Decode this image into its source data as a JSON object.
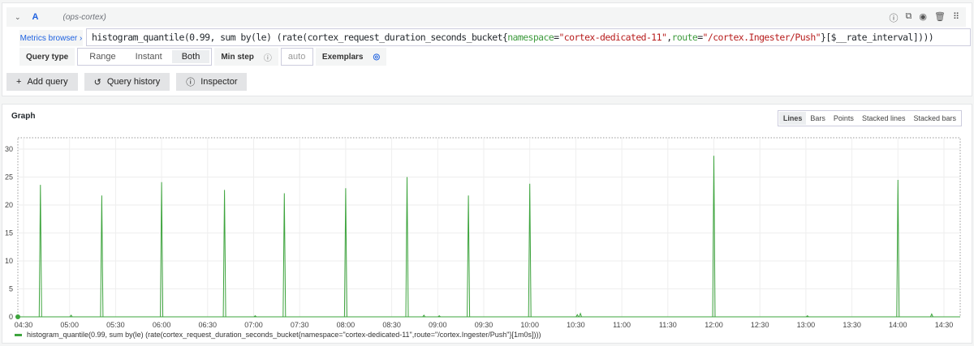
{
  "query": {
    "letter": "A",
    "datasource": "(ops-cortex)",
    "metrics_browser": "Metrics browser ›",
    "expr_parts": [
      "histogram_quantile(0.99, sum by(le) (rate(cortex_request_duration_seconds_bucket{",
      "namespace",
      "=",
      "\"cortex-dedicated-11\"",
      ",",
      "route",
      "=",
      "\"/cortex.Ingester/Push\"",
      "}[$__rate_interval])))"
    ],
    "query_type_label": "Query type",
    "query_types": [
      "Range",
      "Instant",
      "Both"
    ],
    "selected_type": "Both",
    "min_step_label": "Min step",
    "min_step_placeholder": "auto",
    "exemplars_label": "Exemplars"
  },
  "buttons": {
    "add_query": "Add query",
    "query_history": "Query history",
    "inspector": "Inspector"
  },
  "graph": {
    "title": "Graph",
    "modes": [
      "Lines",
      "Bars",
      "Points",
      "Stacked lines",
      "Stacked bars"
    ],
    "selected_mode": "Lines"
  },
  "chart_data": {
    "type": "line",
    "ylim": [
      0,
      30
    ],
    "yticks": [
      0,
      5,
      10,
      15,
      20,
      25,
      30
    ],
    "xticks": [
      "04:30",
      "05:00",
      "05:30",
      "06:00",
      "06:30",
      "07:00",
      "07:30",
      "08:00",
      "08:30",
      "09:00",
      "09:30",
      "10:00",
      "10:30",
      "11:00",
      "11:30",
      "12:00",
      "12:30",
      "13:00",
      "13:30",
      "14:00",
      "14:30"
    ],
    "grid": true,
    "series": [
      {
        "name": "histogram_quantile(0.99, sum by(le) (rate(cortex_request_duration_seconds_bucket{namespace=\"cortex-dedicated-11\",route=\"/cortex.Ingester/Push\"}[1m0s])))",
        "color": "#3da43d",
        "spikes": [
          [
            "04:41",
            23.6
          ],
          [
            "05:21",
            21.7
          ],
          [
            "06:00",
            24.1
          ],
          [
            "06:41",
            22.7
          ],
          [
            "07:20",
            22.1
          ],
          [
            "08:00",
            23.0
          ],
          [
            "08:40",
            25.0
          ],
          [
            "09:20",
            21.7
          ],
          [
            "10:00",
            23.8
          ],
          [
            "12:00",
            28.8
          ],
          [
            "14:00",
            24.5
          ]
        ],
        "bumps": [
          [
            "05:01",
            0.3
          ],
          [
            "07:01",
            0.2
          ],
          [
            "08:51",
            0.3
          ],
          [
            "09:01",
            0.2
          ],
          [
            "10:31",
            0.4
          ],
          [
            "10:33",
            0.6
          ],
          [
            "13:01",
            0.2
          ],
          [
            "14:22",
            0.5
          ]
        ],
        "baseline": 0
      }
    ],
    "legend": "bottom-left"
  }
}
